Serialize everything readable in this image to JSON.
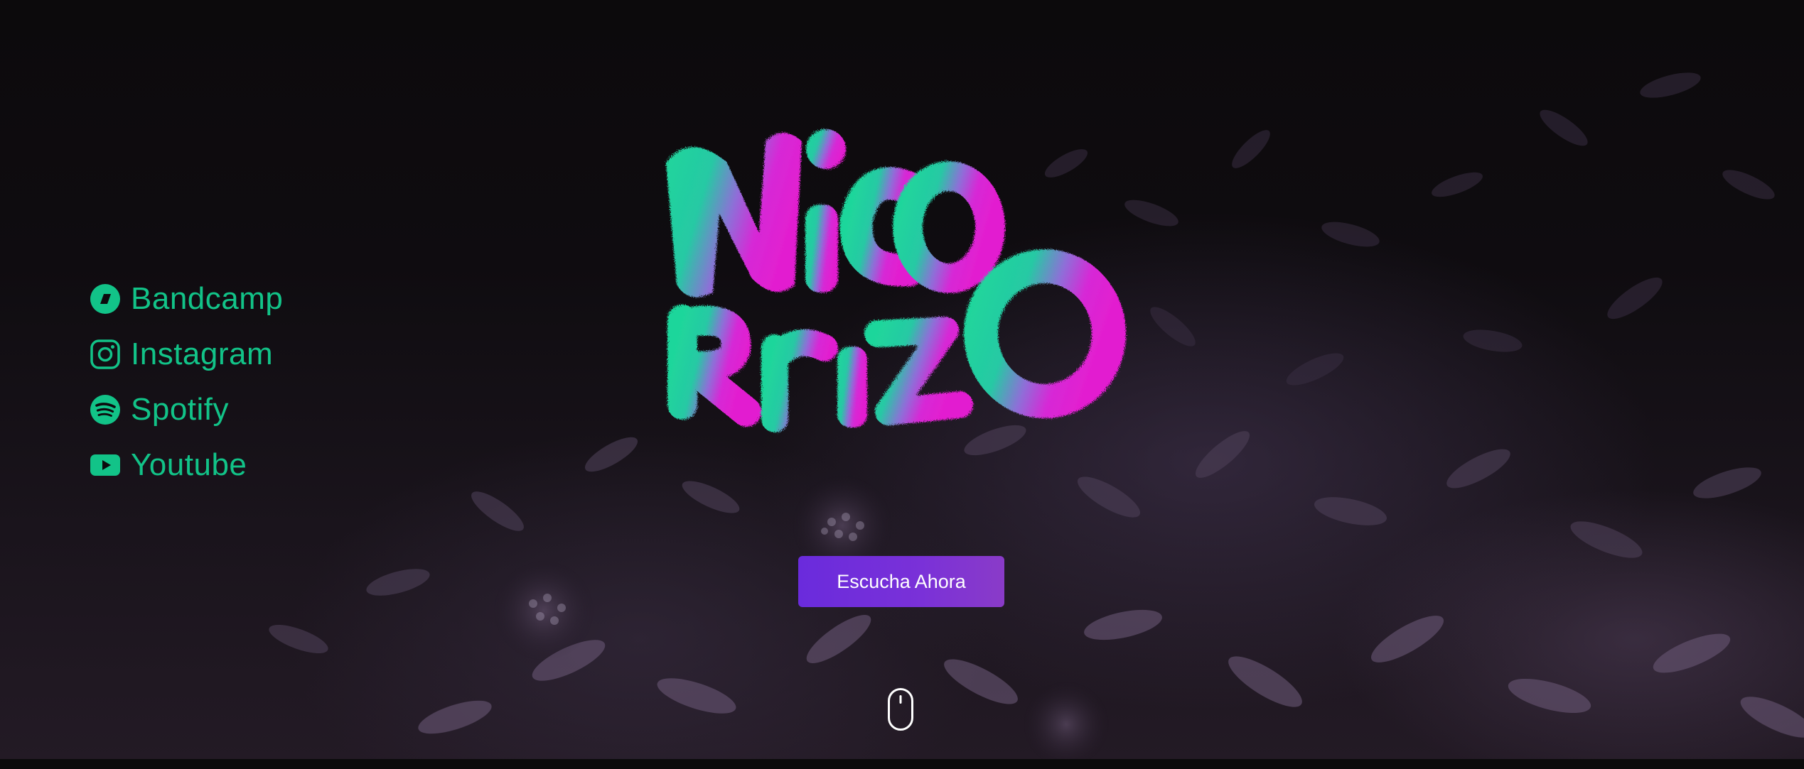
{
  "brand": {
    "logo_text": "Nico Rrizo"
  },
  "social_links": [
    {
      "label": "Bandcamp",
      "icon": "bandcamp-icon"
    },
    {
      "label": "Instagram",
      "icon": "instagram-icon"
    },
    {
      "label": "Spotify",
      "icon": "spotify-icon"
    },
    {
      "label": "Youtube",
      "icon": "youtube-icon"
    }
  ],
  "cta": {
    "label": "Escucha Ahora"
  },
  "scroll_indicator": {
    "icon": "mouse-scroll-icon"
  },
  "colors": {
    "link": "#12c388",
    "cta_start": "#6a2bdc",
    "cta_end": "#8a3bc8",
    "logo_green": "#1fd69b",
    "logo_magenta": "#e21fd0",
    "background": "#0d0a0d"
  }
}
